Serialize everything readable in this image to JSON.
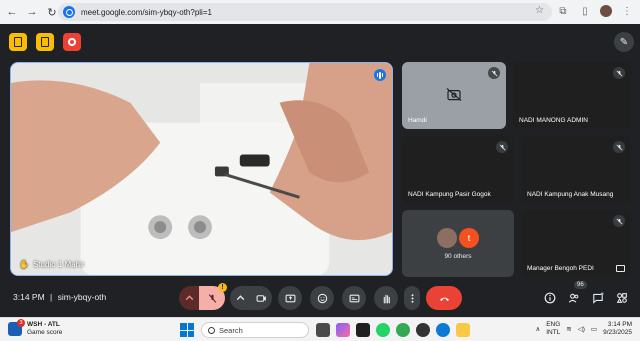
{
  "browser": {
    "url": "meet.google.com/sim-ybqy-oth?pli=1"
  },
  "main_video": {
    "participant": "Studio 1 Mahir"
  },
  "tiles": [
    {
      "name": "Hamdi"
    },
    {
      "name": "NADI MANONG ADMIN"
    },
    {
      "name": "NADI Kampung Pasir Gogok"
    },
    {
      "name": "NADI Kampung Anak Musang"
    },
    {
      "others_label": "90 others",
      "avatar_letter": "t"
    },
    {
      "name": "Manager Bengoh PEDI"
    }
  ],
  "meeting": {
    "time": "3:14 PM",
    "separator": "|",
    "code": "sim-ybqy-oth",
    "participant_count": "96",
    "mic_warning": "!"
  },
  "taskbar": {
    "game_title": "WSH - ATL",
    "game_subtitle": "Game score",
    "search_placeholder": "Search",
    "lang_line1": "ENG",
    "lang_line2": "INTL",
    "clock_time": "3:14 PM",
    "clock_date": "9/23/2025"
  },
  "colors": {
    "accent_blue": "#8ab4f8",
    "end_call_red": "#ea4335",
    "warning_yellow": "#fbbc04"
  }
}
